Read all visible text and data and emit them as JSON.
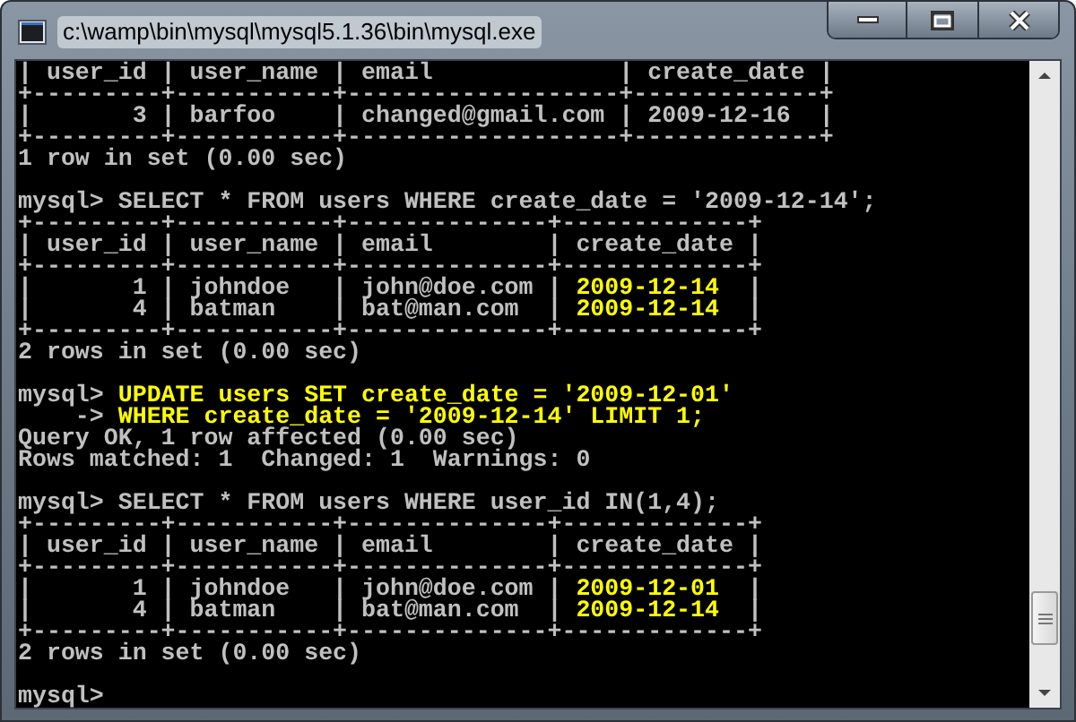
{
  "window": {
    "title": "c:\\wamp\\bin\\mysql\\mysql5.1.36\\bin\\mysql.exe"
  },
  "console": {
    "lines": [
      {
        "kind": "text",
        "segments": [
          {
            "text": "| user_id | user_name | email             | create_date |",
            "highlighted": false
          }
        ]
      },
      {
        "kind": "text",
        "segments": [
          {
            "text": "+---------+-----------+-------------------+-------------+",
            "highlighted": false
          }
        ]
      },
      {
        "kind": "text",
        "segments": [
          {
            "text": "|       3 | barfoo    | changed@gmail.com | 2009-12-16  |",
            "highlighted": false
          }
        ]
      },
      {
        "kind": "text",
        "segments": [
          {
            "text": "+---------+-----------+-------------------+-------------+",
            "highlighted": false
          }
        ]
      },
      {
        "kind": "text",
        "segments": [
          {
            "text": "1 row in set (0.00 sec)",
            "highlighted": false
          }
        ]
      },
      {
        "kind": "blank"
      },
      {
        "kind": "text",
        "segments": [
          {
            "text": "mysql> SELECT * FROM users WHERE create_date = '2009-12-14';",
            "highlighted": false
          }
        ]
      },
      {
        "kind": "text",
        "segments": [
          {
            "text": "+---------+-----------+--------------+-------------+",
            "highlighted": false
          }
        ]
      },
      {
        "kind": "text",
        "segments": [
          {
            "text": "| user_id | user_name | email        | create_date |",
            "highlighted": false
          }
        ]
      },
      {
        "kind": "text",
        "segments": [
          {
            "text": "+---------+-----------+--------------+-------------+",
            "highlighted": false
          }
        ]
      },
      {
        "kind": "text",
        "segments": [
          {
            "text": "|       1 | johndoe   | john@doe.com | ",
            "highlighted": false
          },
          {
            "text": "2009-12-14",
            "highlighted": true
          },
          {
            "text": "  |",
            "highlighted": false
          }
        ]
      },
      {
        "kind": "text",
        "segments": [
          {
            "text": "|       4 | batman    | bat@man.com  | ",
            "highlighted": false
          },
          {
            "text": "2009-12-14",
            "highlighted": true
          },
          {
            "text": "  |",
            "highlighted": false
          }
        ]
      },
      {
        "kind": "text",
        "segments": [
          {
            "text": "+---------+-----------+--------------+-------------+",
            "highlighted": false
          }
        ]
      },
      {
        "kind": "text",
        "segments": [
          {
            "text": "2 rows in set (0.00 sec)",
            "highlighted": false
          }
        ]
      },
      {
        "kind": "blank"
      },
      {
        "kind": "text",
        "segments": [
          {
            "text": "mysql> ",
            "highlighted": false
          },
          {
            "text": "UPDATE users SET create_date = '2009-12-01'",
            "highlighted": true
          }
        ]
      },
      {
        "kind": "text",
        "segments": [
          {
            "text": "    -> ",
            "highlighted": false
          },
          {
            "text": "WHERE create_date = '2009-12-14' LIMIT 1;",
            "highlighted": true
          }
        ]
      },
      {
        "kind": "text",
        "segments": [
          {
            "text": "Query OK, 1 row affected (0.00 sec)",
            "highlighted": false
          }
        ]
      },
      {
        "kind": "text",
        "segments": [
          {
            "text": "Rows matched: 1  Changed: 1  Warnings: 0",
            "highlighted": false
          }
        ]
      },
      {
        "kind": "blank"
      },
      {
        "kind": "text",
        "segments": [
          {
            "text": "mysql> SELECT * FROM users WHERE user_id IN(1,4);",
            "highlighted": false
          }
        ]
      },
      {
        "kind": "text",
        "segments": [
          {
            "text": "+---------+-----------+--------------+-------------+",
            "highlighted": false
          }
        ]
      },
      {
        "kind": "text",
        "segments": [
          {
            "text": "| user_id | user_name | email        | create_date |",
            "highlighted": false
          }
        ]
      },
      {
        "kind": "text",
        "segments": [
          {
            "text": "+---------+-----------+--------------+-------------+",
            "highlighted": false
          }
        ]
      },
      {
        "kind": "text",
        "segments": [
          {
            "text": "|       1 | johndoe   | john@doe.com | ",
            "highlighted": false
          },
          {
            "text": "2009-12-01",
            "highlighted": true
          },
          {
            "text": "  |",
            "highlighted": false
          }
        ]
      },
      {
        "kind": "text",
        "segments": [
          {
            "text": "|       4 | batman    | bat@man.com  | ",
            "highlighted": false
          },
          {
            "text": "2009-12-14",
            "highlighted": true
          },
          {
            "text": "  |",
            "highlighted": false
          }
        ]
      },
      {
        "kind": "text",
        "segments": [
          {
            "text": "+---------+-----------+--------------+-------------+",
            "highlighted": false
          }
        ]
      },
      {
        "kind": "text",
        "segments": [
          {
            "text": "2 rows in set (0.00 sec)",
            "highlighted": false
          }
        ]
      },
      {
        "kind": "blank"
      },
      {
        "kind": "text",
        "segments": [
          {
            "text": "mysql>",
            "highlighted": false
          }
        ]
      }
    ]
  }
}
